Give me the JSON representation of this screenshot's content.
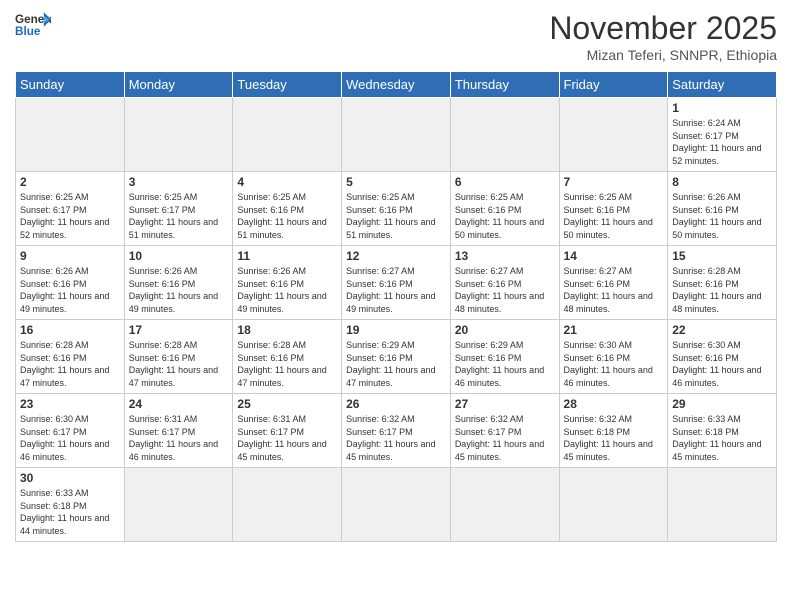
{
  "header": {
    "logo_general": "General",
    "logo_blue": "Blue",
    "month_year": "November 2025",
    "location": "Mizan Teferi, SNNPR, Ethiopia"
  },
  "weekdays": [
    "Sunday",
    "Monday",
    "Tuesday",
    "Wednesday",
    "Thursday",
    "Friday",
    "Saturday"
  ],
  "weeks": [
    [
      {
        "day": "",
        "info": ""
      },
      {
        "day": "",
        "info": ""
      },
      {
        "day": "",
        "info": ""
      },
      {
        "day": "",
        "info": ""
      },
      {
        "day": "",
        "info": ""
      },
      {
        "day": "",
        "info": ""
      },
      {
        "day": "1",
        "info": "Sunrise: 6:24 AM\nSunset: 6:17 PM\nDaylight: 11 hours and 52 minutes."
      }
    ],
    [
      {
        "day": "2",
        "info": "Sunrise: 6:25 AM\nSunset: 6:17 PM\nDaylight: 11 hours and 52 minutes."
      },
      {
        "day": "3",
        "info": "Sunrise: 6:25 AM\nSunset: 6:17 PM\nDaylight: 11 hours and 51 minutes."
      },
      {
        "day": "4",
        "info": "Sunrise: 6:25 AM\nSunset: 6:16 PM\nDaylight: 11 hours and 51 minutes."
      },
      {
        "day": "5",
        "info": "Sunrise: 6:25 AM\nSunset: 6:16 PM\nDaylight: 11 hours and 51 minutes."
      },
      {
        "day": "6",
        "info": "Sunrise: 6:25 AM\nSunset: 6:16 PM\nDaylight: 11 hours and 50 minutes."
      },
      {
        "day": "7",
        "info": "Sunrise: 6:25 AM\nSunset: 6:16 PM\nDaylight: 11 hours and 50 minutes."
      },
      {
        "day": "8",
        "info": "Sunrise: 6:26 AM\nSunset: 6:16 PM\nDaylight: 11 hours and 50 minutes."
      }
    ],
    [
      {
        "day": "9",
        "info": "Sunrise: 6:26 AM\nSunset: 6:16 PM\nDaylight: 11 hours and 49 minutes."
      },
      {
        "day": "10",
        "info": "Sunrise: 6:26 AM\nSunset: 6:16 PM\nDaylight: 11 hours and 49 minutes."
      },
      {
        "day": "11",
        "info": "Sunrise: 6:26 AM\nSunset: 6:16 PM\nDaylight: 11 hours and 49 minutes."
      },
      {
        "day": "12",
        "info": "Sunrise: 6:27 AM\nSunset: 6:16 PM\nDaylight: 11 hours and 49 minutes."
      },
      {
        "day": "13",
        "info": "Sunrise: 6:27 AM\nSunset: 6:16 PM\nDaylight: 11 hours and 48 minutes."
      },
      {
        "day": "14",
        "info": "Sunrise: 6:27 AM\nSunset: 6:16 PM\nDaylight: 11 hours and 48 minutes."
      },
      {
        "day": "15",
        "info": "Sunrise: 6:28 AM\nSunset: 6:16 PM\nDaylight: 11 hours and 48 minutes."
      }
    ],
    [
      {
        "day": "16",
        "info": "Sunrise: 6:28 AM\nSunset: 6:16 PM\nDaylight: 11 hours and 47 minutes."
      },
      {
        "day": "17",
        "info": "Sunrise: 6:28 AM\nSunset: 6:16 PM\nDaylight: 11 hours and 47 minutes."
      },
      {
        "day": "18",
        "info": "Sunrise: 6:28 AM\nSunset: 6:16 PM\nDaylight: 11 hours and 47 minutes."
      },
      {
        "day": "19",
        "info": "Sunrise: 6:29 AM\nSunset: 6:16 PM\nDaylight: 11 hours and 47 minutes."
      },
      {
        "day": "20",
        "info": "Sunrise: 6:29 AM\nSunset: 6:16 PM\nDaylight: 11 hours and 46 minutes."
      },
      {
        "day": "21",
        "info": "Sunrise: 6:30 AM\nSunset: 6:16 PM\nDaylight: 11 hours and 46 minutes."
      },
      {
        "day": "22",
        "info": "Sunrise: 6:30 AM\nSunset: 6:16 PM\nDaylight: 11 hours and 46 minutes."
      }
    ],
    [
      {
        "day": "23",
        "info": "Sunrise: 6:30 AM\nSunset: 6:17 PM\nDaylight: 11 hours and 46 minutes."
      },
      {
        "day": "24",
        "info": "Sunrise: 6:31 AM\nSunset: 6:17 PM\nDaylight: 11 hours and 46 minutes."
      },
      {
        "day": "25",
        "info": "Sunrise: 6:31 AM\nSunset: 6:17 PM\nDaylight: 11 hours and 45 minutes."
      },
      {
        "day": "26",
        "info": "Sunrise: 6:32 AM\nSunset: 6:17 PM\nDaylight: 11 hours and 45 minutes."
      },
      {
        "day": "27",
        "info": "Sunrise: 6:32 AM\nSunset: 6:17 PM\nDaylight: 11 hours and 45 minutes."
      },
      {
        "day": "28",
        "info": "Sunrise: 6:32 AM\nSunset: 6:18 PM\nDaylight: 11 hours and 45 minutes."
      },
      {
        "day": "29",
        "info": "Sunrise: 6:33 AM\nSunset: 6:18 PM\nDaylight: 11 hours and 45 minutes."
      }
    ],
    [
      {
        "day": "30",
        "info": "Sunrise: 6:33 AM\nSunset: 6:18 PM\nDaylight: 11 hours and 44 minutes."
      },
      {
        "day": "",
        "info": ""
      },
      {
        "day": "",
        "info": ""
      },
      {
        "day": "",
        "info": ""
      },
      {
        "day": "",
        "info": ""
      },
      {
        "day": "",
        "info": ""
      },
      {
        "day": "",
        "info": ""
      }
    ]
  ]
}
